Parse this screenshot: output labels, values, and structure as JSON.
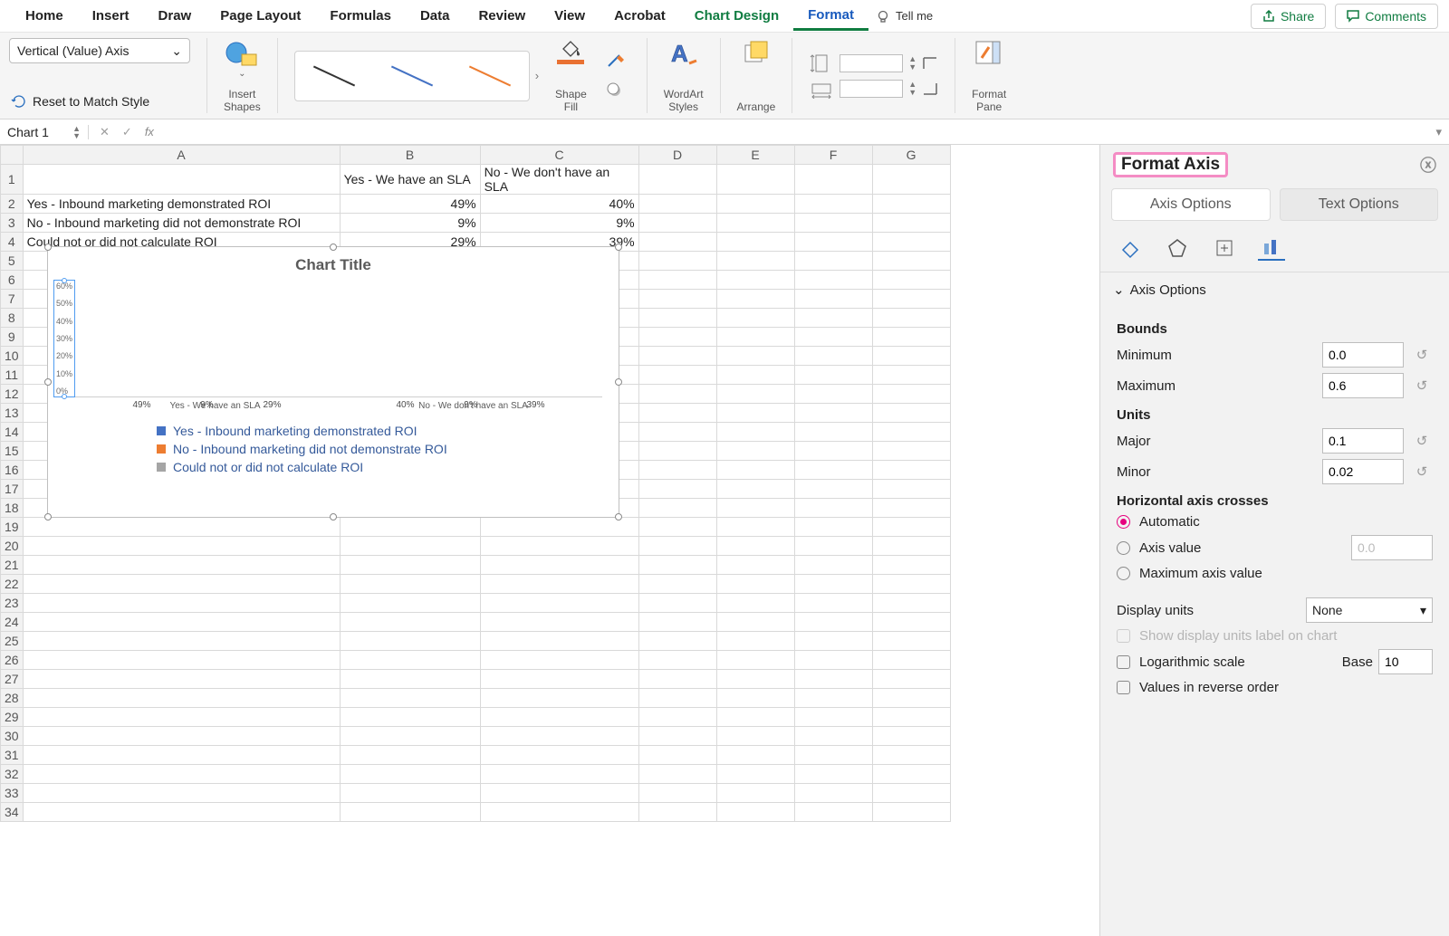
{
  "tabs": [
    "Home",
    "Insert",
    "Draw",
    "Page Layout",
    "Formulas",
    "Data",
    "Review",
    "View",
    "Acrobat",
    "Chart Design",
    "Format"
  ],
  "tellme": "Tell me",
  "share": "Share",
  "comments": "Comments",
  "ribbon": {
    "element_select": "Vertical (Value) Axis",
    "reset": "Reset to Match Style",
    "insert_shapes": "Insert\nShapes",
    "shape_fill": "Shape\nFill",
    "wordart": "WordArt\nStyles",
    "arrange": "Arrange",
    "format_pane": "Format\nPane"
  },
  "namebox": "Chart 1",
  "sheet": {
    "headers": [
      "A",
      "B",
      "C",
      "D",
      "E",
      "F",
      "G"
    ],
    "rows": [
      {
        "A": "",
        "B": "Yes - We have an SLA",
        "C": "No - We don't have an SLA"
      },
      {
        "A": "Yes - Inbound marketing demonstrated ROI",
        "B": "49%",
        "C": "40%"
      },
      {
        "A": "No - Inbound marketing did not demonstrate ROI",
        "B": "9%",
        "C": "9%"
      },
      {
        "A": "Could not or did not calculate ROI",
        "B": "29%",
        "C": "39%"
      }
    ]
  },
  "chart_data": {
    "type": "bar",
    "title": "Chart Title",
    "categories": [
      "Yes - We have an SLA",
      "No - We don't have an SLA"
    ],
    "series": [
      {
        "name": "Yes - Inbound marketing demonstrated ROI",
        "values": [
          49,
          40
        ],
        "color": "#4472c4"
      },
      {
        "name": "No - Inbound marketing did not demonstrate ROI",
        "values": [
          9,
          9
        ],
        "color": "#ed7d31"
      },
      {
        "name": "Could not or did not calculate ROI",
        "values": [
          29,
          39
        ],
        "color": "#a5a5a5"
      }
    ],
    "ylabel": "",
    "xlabel": "",
    "ylim": [
      0,
      60
    ],
    "yticks": [
      "60%",
      "50%",
      "40%",
      "30%",
      "20%",
      "10%",
      "0%"
    ]
  },
  "pane": {
    "title": "Format Axis",
    "tab1": "Axis Options",
    "tab2": "Text Options",
    "section": "Axis Options",
    "bounds": "Bounds",
    "minimum": "Minimum",
    "minimum_v": "0.0",
    "maximum": "Maximum",
    "maximum_v": "0.6",
    "units": "Units",
    "major": "Major",
    "major_v": "0.1",
    "minor": "Minor",
    "minor_v": "0.02",
    "crosses": "Horizontal axis crosses",
    "automatic": "Automatic",
    "axis_value": "Axis value",
    "axis_value_v": "0.0",
    "max_axis": "Maximum axis value",
    "display_units": "Display units",
    "display_units_v": "None",
    "show_label": "Show display units label on chart",
    "log": "Logarithmic scale",
    "base": "Base",
    "base_v": "10",
    "reverse": "Values in reverse order"
  }
}
